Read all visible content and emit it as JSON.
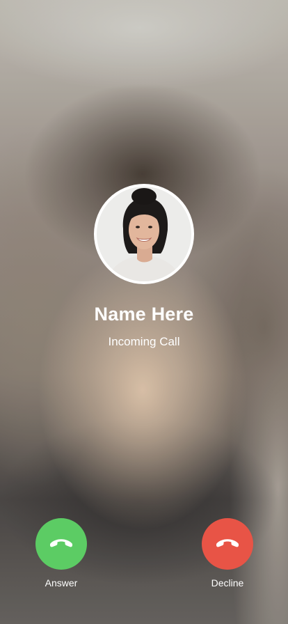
{
  "caller": {
    "name": "Name Here",
    "status": "Incoming Call"
  },
  "actions": {
    "answer_label": "Answer",
    "decline_label": "Decline"
  },
  "icons": {
    "answer": "phone-answer-icon",
    "decline": "phone-decline-icon"
  },
  "colors": {
    "answer": "#5ccc64",
    "decline": "#e85446",
    "text": "#ffffff"
  }
}
